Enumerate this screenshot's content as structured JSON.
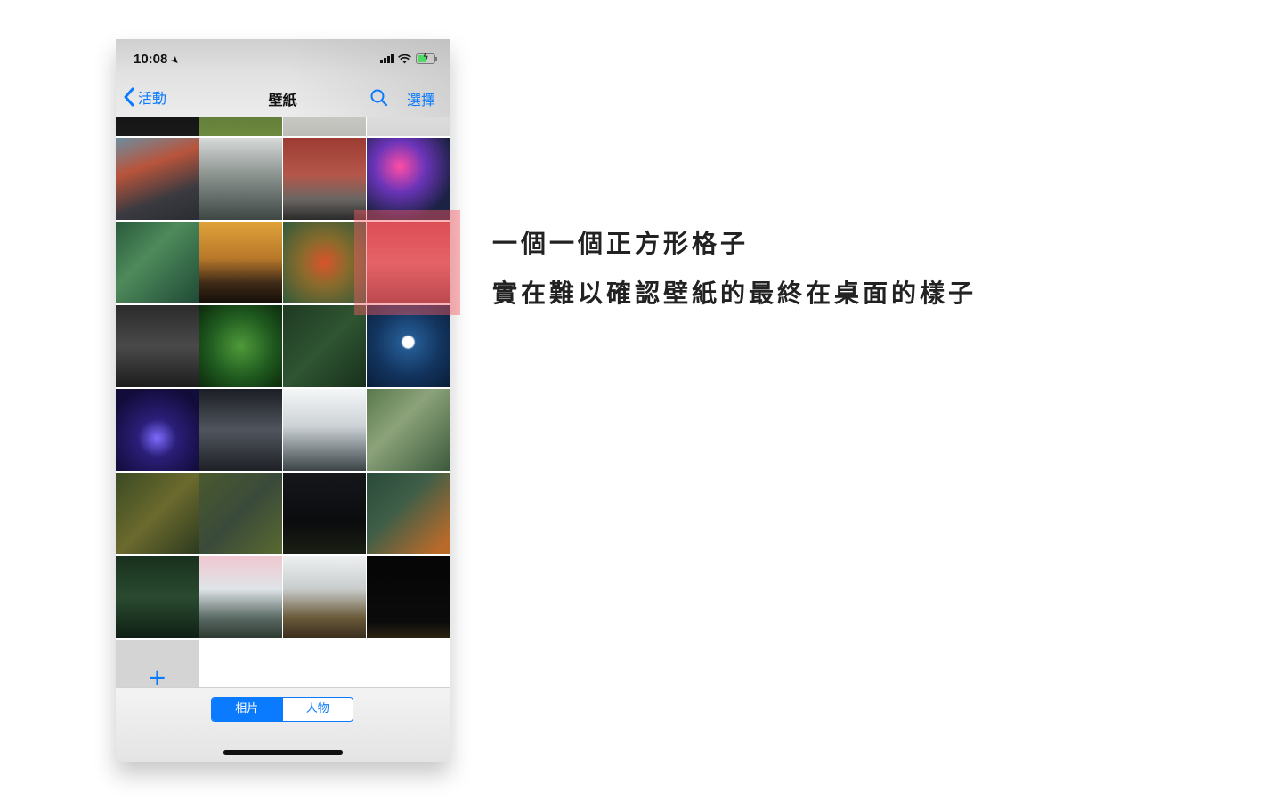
{
  "status_bar": {
    "time": "10:08",
    "location_icon": "location-arrow-icon",
    "signal_icon": "cellular-signal-icon",
    "wifi_icon": "wifi-icon",
    "battery_icon": "battery-charging-icon",
    "battery_level": 0.6
  },
  "nav": {
    "back_label": "活動",
    "back_icon": "chevron-left-icon",
    "title": "壁紙",
    "search_icon": "search-icon",
    "select_label": "選擇"
  },
  "album_grid": {
    "tiles": [
      {
        "name": "photo-dark-top",
        "bg": "linear-gradient(180deg,#050505,#1a1a1a)"
      },
      {
        "name": "photo-green-top",
        "bg": "linear-gradient(180deg,#3d5a2a,#6e8a3f)"
      },
      {
        "name": "photo-desk-top",
        "bg": "linear-gradient(180deg,#e8e8e6,#bdbdb8)"
      },
      {
        "name": "photo-white-top",
        "bg": "linear-gradient(180deg,#f2f2f2,#d6d6d6)"
      },
      {
        "name": "photo-city-crossing",
        "bg": "linear-gradient(160deg,#6d8da0 0%,#b8543b 35%,#3a3a40 70%,#2a2d33 100%)"
      },
      {
        "name": "photo-skyscrapers",
        "bg": "linear-gradient(180deg,#d6d9d8 0%,#8c9490 45%,#3f4745 100%)"
      },
      {
        "name": "photo-brick-building-bus",
        "bg": "linear-gradient(180deg,#9c3b32 0%,#b4574a 45%,#6a6663 75%,#2b2b2b 100%)"
      },
      {
        "name": "photo-neon-night-street",
        "bg": "radial-gradient(circle at 40% 35%,#ff4da6 0%,#6a34b8 35%,#1c2244 75%)"
      },
      {
        "name": "photo-winding-road-forest",
        "bg": "linear-gradient(135deg,#2a5a3c 0%,#4e8a5b 40%,#1f4a36 100%)"
      },
      {
        "name": "photo-golden-mountains",
        "bg": "linear-gradient(180deg,#e0a33a 0%,#b8782a 45%,#3f2a18 75%,#140e08 100%)"
      },
      {
        "name": "photo-autumn-treetops",
        "bg": "radial-gradient(circle at 50% 50%,#d9542b 0%,#8a6b2c 40%,#2f5a3a 100%)"
      },
      {
        "name": "photo-golden-gate-bridge",
        "bg": "linear-gradient(180deg,#c9434b 0%,#d86a6a 50%,#8c3a3e 100%)"
      },
      {
        "name": "photo-iphone-internals",
        "bg": "linear-gradient(180deg,#2b2b2b 0%,#4a4a4a 50%,#1d1d1d 100%)"
      },
      {
        "name": "photo-fern-leaves",
        "bg": "radial-gradient(circle at 50% 50%,#4f9a3a 0%,#1f5a1f 55%,#0c2a0c 100%)"
      },
      {
        "name": "photo-green-forest-aerial",
        "bg": "linear-gradient(135deg,#1f3a22 0%,#2f5532 50%,#18301c 100%)"
      },
      {
        "name": "photo-wolf-moon",
        "bg": "radial-gradient(circle at 50% 45%,#ffffff 0%,#ffffff 9%,#245a92 12%,#12345e 55%,#0a1e38 100%)"
      },
      {
        "name": "photo-night-blue-car",
        "bg": "radial-gradient(circle at 50% 60%,#7d6bff 0%,#2a1e78 30%,#120c3a 80%)"
      },
      {
        "name": "photo-tunnel-road",
        "bg": "linear-gradient(180deg,#1b1e24 0%,#50555d 50%,#1e2126 100%)"
      },
      {
        "name": "photo-misty-mountains",
        "bg": "linear-gradient(180deg,#f4f6f7 0%,#cdd3d6 45%,#3c4448 100%)"
      },
      {
        "name": "photo-river-valley",
        "bg": "linear-gradient(135deg,#58784a 0%,#8ca37a 40%,#3c5a3c 100%)"
      },
      {
        "name": "photo-forest-path",
        "bg": "linear-gradient(135deg,#3a4a22 0%,#6b6a2e 50%,#2c3a1e 100%)"
      },
      {
        "name": "photo-curved-road-forest",
        "bg": "linear-gradient(135deg,#4a5a2e 0%,#3a4a3a 50%,#5a6a30 100%)"
      },
      {
        "name": "photo-night-trees",
        "bg": "linear-gradient(180deg,#15171b 0%,#0b0c0e 60%,#1a1f14 100%)"
      },
      {
        "name": "photo-lake-shore-aerial",
        "bg": "linear-gradient(135deg,#2a4a3a 0%,#3e5e48 40%,#b86a2a 90%)"
      },
      {
        "name": "photo-pine-forest",
        "bg": "linear-gradient(180deg,#18301e 0%,#2a4a30 50%,#0f1f14 100%)"
      },
      {
        "name": "photo-snowy-mountains-pink",
        "bg": "linear-gradient(180deg,#f0c8d0 0%,#dfe4e8 40%,#5a6a64 75%,#2e3a32 100%)"
      },
      {
        "name": "photo-foggy-valley",
        "bg": "linear-gradient(180deg,#eef0f0 0%,#c9cccc 40%,#6a5a3a 75%,#3a2e1e 100%)"
      },
      {
        "name": "photo-dark-night-road",
        "bg": "linear-gradient(180deg,#050505 0%,#0b0b0b 80%,#2a2414 100%)"
      }
    ],
    "add_button_label": "+"
  },
  "bottom_bar": {
    "segments": [
      {
        "label": "相片",
        "selected": true
      },
      {
        "label": "人物",
        "selected": false
      }
    ]
  },
  "caption": {
    "line1": "一個一個正方形格子",
    "line2": "實在難以確認壁紙的最終在桌面的樣子"
  },
  "colors": {
    "accent": "#0a7aff",
    "highlight": "#f55a64"
  }
}
